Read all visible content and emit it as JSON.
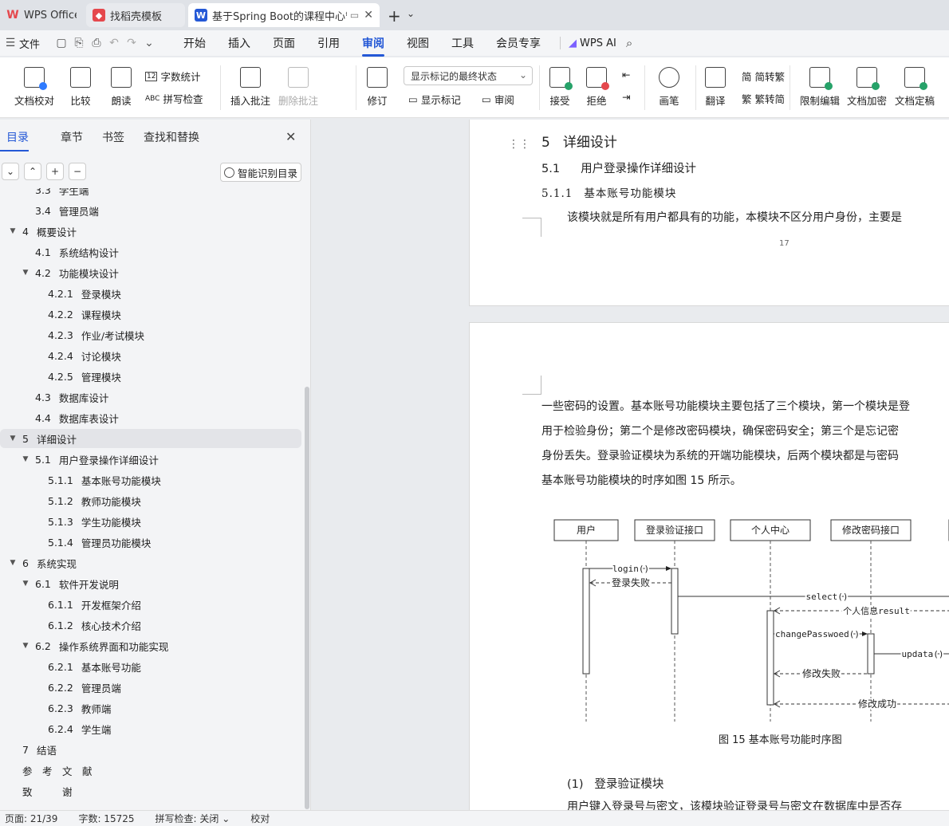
{
  "tabs": [
    {
      "label": "WPS Office"
    },
    {
      "label": "找稻壳模板"
    },
    {
      "label": "基于Spring Boot的课程中心管理系统"
    }
  ],
  "menu": [
    "开始",
    "插入",
    "页面",
    "引用",
    "审阅",
    "视图",
    "工具",
    "会员专享"
  ],
  "menu_active": "审阅",
  "wps_ai": "WPS AI",
  "ribbon": {
    "doc_check": "文档校对",
    "compare": "比较",
    "read_aloud": "朗读",
    "word_count": "字数统计",
    "spell_check": "拼写检查",
    "insert_comment": "插入批注",
    "delete_comment": "删除批注",
    "revise": "修订",
    "markup_state": "显示标记的最终状态",
    "show_markup": "显示标记",
    "review": "审阅",
    "accept": "接受",
    "reject": "拒绝",
    "pen": "画笔",
    "translate": "翻译",
    "trad": "简转繁",
    "simp": "繁转简",
    "restrict_edit": "限制编辑",
    "encrypt": "文档加密",
    "finalize": "文档定稿"
  },
  "sidebar": {
    "tabs": [
      "目录",
      "章节",
      "书签",
      "查找和替换"
    ],
    "smart_toc": "智能识别目录",
    "toc": [
      {
        "num": "3.3",
        "title": "学生端",
        "level": 2,
        "tri": ""
      },
      {
        "num": "3.4",
        "title": "管理员端",
        "level": 2,
        "tri": ""
      },
      {
        "num": "4",
        "title": "概要设计",
        "level": 1,
        "tri": "▼"
      },
      {
        "num": "4.1",
        "title": "系统结构设计",
        "level": 2,
        "tri": ""
      },
      {
        "num": "4.2",
        "title": "功能模块设计",
        "level": 2,
        "tri": "▼"
      },
      {
        "num": "4.2.1",
        "title": "登录模块",
        "level": 3,
        "tri": ""
      },
      {
        "num": "4.2.2",
        "title": "课程模块",
        "level": 3,
        "tri": ""
      },
      {
        "num": "4.2.3",
        "title": "作业/考试模块",
        "level": 3,
        "tri": ""
      },
      {
        "num": "4.2.4",
        "title": "讨论模块",
        "level": 3,
        "tri": ""
      },
      {
        "num": "4.2.5",
        "title": "管理模块",
        "level": 3,
        "tri": ""
      },
      {
        "num": "4.3",
        "title": "数据库设计",
        "level": 2,
        "tri": ""
      },
      {
        "num": "4.4",
        "title": "数据库表设计",
        "level": 2,
        "tri": ""
      },
      {
        "num": "5",
        "title": "详细设计",
        "level": 1,
        "tri": "▼",
        "selected": true
      },
      {
        "num": "5.1",
        "title": "用户登录操作详细设计",
        "level": 2,
        "tri": "▼"
      },
      {
        "num": "5.1.1",
        "title": "基本账号功能模块",
        "level": 3,
        "tri": ""
      },
      {
        "num": "5.1.2",
        "title": "教师功能模块",
        "level": 3,
        "tri": ""
      },
      {
        "num": "5.1.3",
        "title": "学生功能模块",
        "level": 3,
        "tri": ""
      },
      {
        "num": "5.1.4",
        "title": "管理员功能模块",
        "level": 3,
        "tri": ""
      },
      {
        "num": "6",
        "title": "系统实现",
        "level": 1,
        "tri": "▼"
      },
      {
        "num": "6.1",
        "title": "软件开发说明",
        "level": 2,
        "tri": "▼"
      },
      {
        "num": "6.1.1",
        "title": "开发框架介绍",
        "level": 3,
        "tri": ""
      },
      {
        "num": "6.1.2",
        "title": "核心技术介绍",
        "level": 3,
        "tri": ""
      },
      {
        "num": "6.2",
        "title": "操作系统界面和功能实现",
        "level": 2,
        "tri": "▼"
      },
      {
        "num": "6.2.1",
        "title": "基本账号功能",
        "level": 3,
        "tri": ""
      },
      {
        "num": "6.2.2",
        "title": "管理员端",
        "level": 3,
        "tri": ""
      },
      {
        "num": "6.2.3",
        "title": "教师端",
        "level": 3,
        "tri": ""
      },
      {
        "num": "6.2.4",
        "title": "学生端",
        "level": 3,
        "tri": ""
      },
      {
        "num": "7",
        "title": "结语",
        "level": 1,
        "tri": ""
      },
      {
        "num": "",
        "title": "参　考　文　献",
        "level": 1,
        "tri": ""
      },
      {
        "num": "",
        "title": "致　　　谢",
        "level": 1,
        "tri": ""
      }
    ]
  },
  "doc": {
    "h1_num": "5",
    "h1": "详细设计",
    "h2_num": "5.1",
    "h2": "用户登录操作详细设计",
    "h3_num": "5.1.1",
    "h3": "基本账号功能模块",
    "p1": "该模块就是所有用户都具有的功能，本模块不区分用户身份，主要是",
    "page_num": "17",
    "p2_lines": [
      "一些密码的设置。基本账号功能模块主要包括了三个模块，第一个模块是登",
      "用于检验身份；第二个是修改密码模块，确保密码安全；第三个是忘记密",
      "身份丢失。登录验证模块为系统的开端功能模块，后两个模块都是与密码",
      "基本账号功能模块的时序如图 15 所示。"
    ],
    "diagram": {
      "actors": [
        "用户",
        "登录验证接口",
        "个人中心",
        "修改密码接口"
      ],
      "messages": {
        "login": "login()",
        "login_fail": "登录失败",
        "select": "select()",
        "result": "个人信息result",
        "change": "changePasswoed()",
        "update": "updata()",
        "change_fail": "修改失败",
        "change_ok": "修改成功"
      },
      "caption": "图 15  基本账号功能时序图"
    },
    "sub_heading": "(1)   登录验证模块",
    "last_line": "用户键入登录号与密文，该模块验证登录号与密文在数据库中是否存"
  },
  "status": {
    "page": "页面: 21/39",
    "words": "字数: 15725",
    "spell": "拼写检查: 关闭",
    "proof": "校对"
  }
}
